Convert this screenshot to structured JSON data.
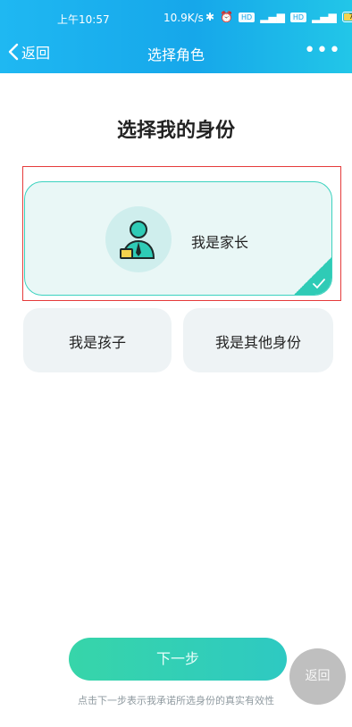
{
  "status_bar": {
    "time": "上午10:57",
    "network_speed": "10.9K/s",
    "battery": "76"
  },
  "navbar": {
    "back_label": "返回",
    "title": "选择角色",
    "more_label": "•••"
  },
  "page": {
    "heading": "选择我的身份"
  },
  "options": {
    "parent": {
      "label": "我是家长",
      "selected": true
    },
    "child": {
      "label": "我是孩子"
    },
    "other": {
      "label": "我是其他身份"
    }
  },
  "footer": {
    "next_label": "下一步",
    "disclaimer": "点击下一步表示我承诺所选身份的真实有效性",
    "floating_back": "返回"
  },
  "colors": {
    "header": "#16a7ea",
    "accent": "#2fcbb6",
    "highlight": "#e53b3b"
  }
}
